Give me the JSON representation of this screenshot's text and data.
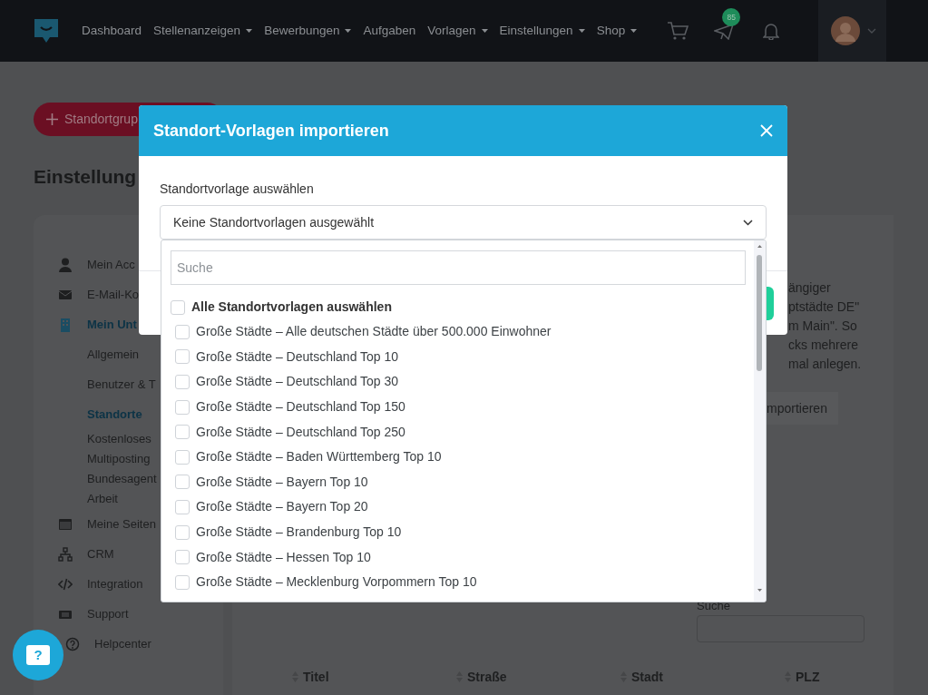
{
  "navbar": {
    "menu": [
      {
        "label": "Dashboard",
        "has_menu": false
      },
      {
        "label": "Stellenanzeigen",
        "has_menu": true
      },
      {
        "label": "Bewerbungen",
        "has_menu": true
      },
      {
        "label": "Aufgaben",
        "has_menu": false
      },
      {
        "label": "Vorlagen",
        "has_menu": true
      },
      {
        "label": "Einstellungen",
        "has_menu": true
      },
      {
        "label": "Shop",
        "has_menu": true
      }
    ],
    "notification_badge": "85"
  },
  "page": {
    "add_button": "Standortgrup",
    "heading": "Einstellung",
    "sidebar": [
      {
        "label": "Mein Acc",
        "selected": false
      },
      {
        "label": "E-Mail-Ko",
        "selected": false
      },
      {
        "label": "Mein Unt",
        "selected": true,
        "children": [
          {
            "label": "Allgemein",
            "selected": false
          },
          {
            "label": "Benutzer & T",
            "selected": false
          },
          {
            "label": "Standorte",
            "selected": true
          },
          {
            "label": "Kostenloses Multiposting",
            "selected": false
          },
          {
            "label": "Bundesagent Arbeit",
            "selected": false
          }
        ]
      },
      {
        "label": "Meine Seiten",
        "selected": false
      },
      {
        "label": "CRM",
        "selected": false
      },
      {
        "label": "Integration",
        "selected": false
      },
      {
        "label": "Support",
        "selected": false
      },
      {
        "label": "Helpcenter",
        "selected": false
      }
    ],
    "description_lines": [
      "ängiger",
      "ptstädte DE\"",
      "m Main\". So",
      "cks mehrere",
      "mal anlegen."
    ],
    "import_button": "mportieren",
    "search_label": "Suche",
    "table_columns": [
      "Titel",
      "Straße",
      "Stadt",
      "PLZ"
    ]
  },
  "modal": {
    "title": "Standort-Vorlagen importieren",
    "field_label": "Standortvorlage auswählen",
    "select_value": "Keine Standortvorlagen ausgewählt",
    "search_placeholder": "Suche",
    "select_all": {
      "label": "Alle Standortvorlagen auswählen",
      "checked": false
    },
    "options": [
      {
        "label": "Große Städte – Alle deutschen Städte über 500.000 Einwohner",
        "checked": false
      },
      {
        "label": "Große Städte – Deutschland Top 10",
        "checked": false
      },
      {
        "label": "Große Städte – Deutschland Top 30",
        "checked": false
      },
      {
        "label": "Große Städte – Deutschland Top 150",
        "checked": false
      },
      {
        "label": "Große Städte – Deutschland Top 250",
        "checked": false
      },
      {
        "label": "Große Städte – Baden Württemberg Top 10",
        "checked": false
      },
      {
        "label": "Große Städte – Bayern Top 10",
        "checked": false
      },
      {
        "label": "Große Städte – Bayern Top 20",
        "checked": false
      },
      {
        "label": "Große Städte – Brandenburg Top 10",
        "checked": false
      },
      {
        "label": "Große Städte – Hessen Top 10",
        "checked": false
      },
      {
        "label": "Große Städte – Mecklenburg Vorpommern Top 10",
        "checked": false
      }
    ]
  },
  "help_button": {
    "label": "?"
  }
}
